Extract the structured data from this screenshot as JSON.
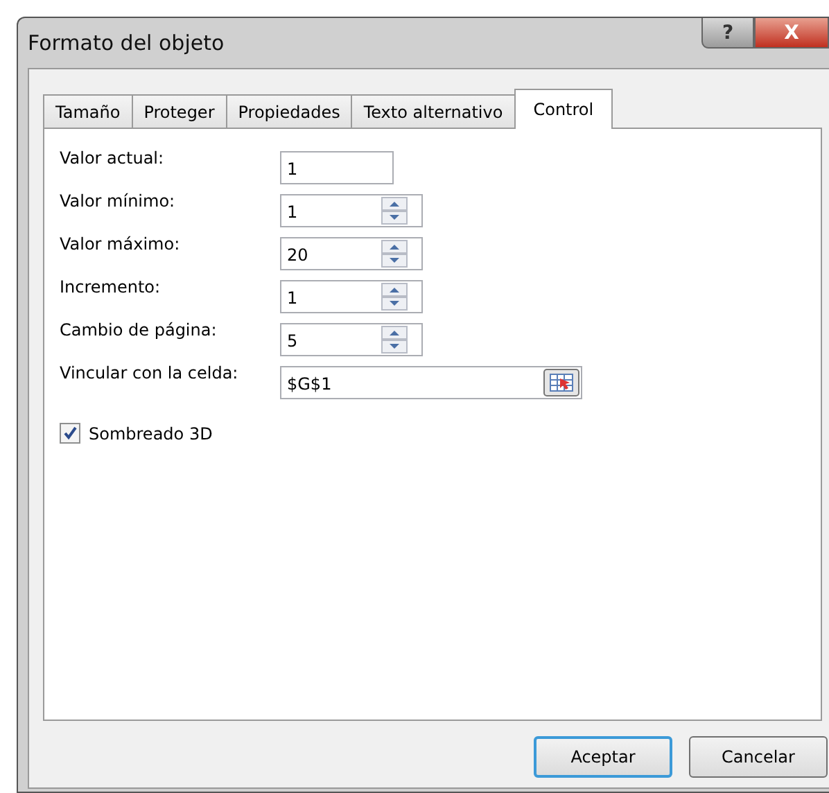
{
  "window": {
    "title": "Formato del objeto",
    "help_button": "?",
    "close_button": "X"
  },
  "tabs": [
    {
      "label": "Tamaño",
      "selected": false
    },
    {
      "label": "Proteger",
      "selected": false
    },
    {
      "label": "Propiedades",
      "selected": false
    },
    {
      "label": "Texto alternativo",
      "selected": false
    },
    {
      "label": "Control",
      "selected": true
    }
  ],
  "fields": [
    {
      "kind": "plain",
      "label": "Valor actual:",
      "value": "1"
    },
    {
      "kind": "spin",
      "label": "Valor mínimo:",
      "value": "1"
    },
    {
      "kind": "spin",
      "label": "Valor máximo:",
      "value": "20"
    },
    {
      "kind": "spin",
      "label": "Incremento:",
      "value": "1"
    },
    {
      "kind": "spin",
      "label": "Cambio de página:",
      "value": "5"
    },
    {
      "kind": "ref",
      "label": "Vincular con la celda:",
      "value": "$G$1"
    }
  ],
  "checkbox": {
    "label": "Sombreado 3D",
    "checked": true
  },
  "buttons": [
    {
      "label": "Aceptar",
      "default": true
    },
    {
      "label": "Cancelar",
      "default": false
    }
  ]
}
